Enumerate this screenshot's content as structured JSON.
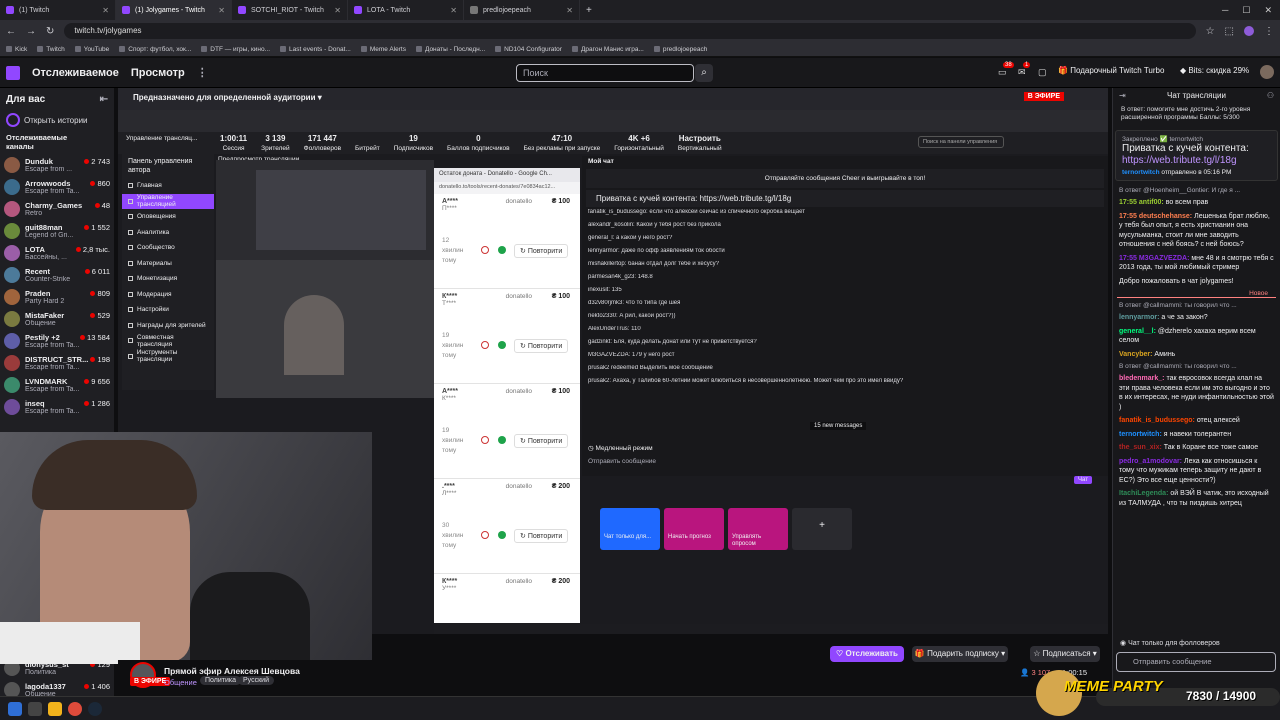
{
  "browser": {
    "tabs": [
      {
        "label": "(1) Twitch",
        "active": false
      },
      {
        "label": "(1) Jolygames - Twitch",
        "active": true
      },
      {
        "label": "SOTCHI_RIOT - Twitch",
        "active": false
      },
      {
        "label": "LOTA - Twitch",
        "active": false
      },
      {
        "label": "predlojoepeach",
        "active": false
      }
    ],
    "url": "twitch.tv/jolygames",
    "bookmarks": [
      "Kick",
      "Twitch",
      "YouTube",
      "Спорт: футбол, хок...",
      "DTF — игры, кино...",
      "Last events - Donat...",
      "Meme Alerts",
      "Донаты - Последн...",
      "ND104 Configurator",
      "Драгон Манис игра...",
      "predlojoepeach"
    ]
  },
  "header": {
    "following": "Отслеживаемое",
    "browse": "Просмотр",
    "search_placeholder": "Поиск",
    "notif_badge_1": "38",
    "notif_badge_2": "1",
    "turbo": "Подарочный Twitch Turbo",
    "bits": "Bits: скидка 29%"
  },
  "sidebar": {
    "title": "Для вас",
    "stories": "Открыть истории",
    "followed": "Отслеживаемые каналы",
    "channels": [
      {
        "name": "Dunduk",
        "game": "Escape from ...",
        "viewers": "2 743",
        "extra": "Скидка • Закончивается"
      },
      {
        "name": "Arrowwoods",
        "game": "Escape from Ta...",
        "viewers": "860"
      },
      {
        "name": "Charmy_Games",
        "game": "Retro",
        "viewers": "48"
      },
      {
        "name": "guit88man",
        "game": "Legend of Gri...",
        "viewers": "1 552"
      },
      {
        "name": "LOTA",
        "game": "Бассейны, ...",
        "viewers": "2,8 тыс."
      },
      {
        "name": "Recent",
        "game": "Counter-Strike",
        "viewers": "6 011"
      },
      {
        "name": "Praden",
        "game": "Party Hard 2",
        "viewers": "809"
      },
      {
        "name": "MistaFaker",
        "game": "Общение",
        "viewers": "529"
      },
      {
        "name": "Pestily +2",
        "game": "Escape from Ta...",
        "viewers": "13 584"
      },
      {
        "name": "DISTRUCT_STR...",
        "game": "Escape from Ta...",
        "viewers": "198"
      },
      {
        "name": "LVNDMARK",
        "game": "Escape from Ta...",
        "viewers": "9 656"
      },
      {
        "name": "inseq",
        "game": "Escape from Ta...",
        "viewers": "1 286"
      }
    ],
    "bottom_channels": [
      {
        "name": "dionysus_st",
        "game": "Политика",
        "viewers": "129"
      },
      {
        "name": "lagoda1337",
        "game": "Общение",
        "viewers": "1 406"
      }
    ]
  },
  "dashboard": {
    "audience": "Предназначено для определенной аудитории",
    "live": "В ЭФИРЕ",
    "title": "Управление трансляц...",
    "stats": [
      {
        "v": "1:00:11",
        "l": "Сессия"
      },
      {
        "v": "3 139",
        "l": "Зрителей"
      },
      {
        "v": "171 447",
        "l": "Фолловеров"
      },
      {
        "v": "",
        "l": "Битрейт"
      },
      {
        "v": "19",
        "l": "Подписчиков"
      },
      {
        "v": "0",
        "l": "Баллов подписчиков"
      },
      {
        "v": "47:10",
        "l": "Без рекламы при запуске"
      },
      {
        "v": "4K +6",
        "l": "Горизонтальный"
      },
      {
        "v": "Настроить",
        "l": "Вертикальный"
      }
    ],
    "panel_title": "Панель управления автора",
    "menu": [
      "Главная",
      "Управление трансляцией",
      "Оповещения",
      "Аналитика",
      "Сообщество",
      "Материалы",
      "Монетизация",
      "Модерация",
      "Настройки",
      "Награды для зрителей",
      "Совместная трансляция",
      "Инструменты трансляции"
    ],
    "preview_label": "Предпросмотр трансляции",
    "chat_label": "Мой чат",
    "search_panel": "Поиск на панели управления"
  },
  "donations": {
    "window_title": "Остаток доната - Donatello - Google Ch...",
    "url": "donatello.to/tools/recent-donates/7e0834ac12...",
    "retry": "Повторити",
    "items": [
      {
        "name": "А****",
        "sub": "П****",
        "src": "donatello",
        "amount": "₴ 100",
        "time": "12 хвилин тому"
      },
      {
        "name": "К****",
        "sub": "Т****",
        "src": "donatello",
        "amount": "₴ 100",
        "time": "19 хвилин тому"
      },
      {
        "name": "А****",
        "sub": "К****",
        "src": "donatello",
        "amount": "₴ 100",
        "time": "19 хвилин тому"
      },
      {
        "name": ".****",
        "sub": "Л****",
        "src": "donatello",
        "amount": "₴ 200",
        "time": "30 хвилин тому"
      },
      {
        "name": "К****",
        "sub": "У****",
        "src": "donatello",
        "amount": "₴ 200",
        "time": ""
      }
    ]
  },
  "dash_chat": {
    "cheer": "Отправляйте сообщения Cheer и выигрывайте в топ!",
    "pinned": "Приватка с кучей контента: https://web.tribute.tg/l/18g",
    "lines": [
      "fanatik_is_budussego: если что алексей сейчас из спичечного окробка вещает",
      "alexandr_kosolin: Какой у тебя рост без прикола",
      "general_l: а какой у него рост?",
      "lennyarmor: даже по офф заявлениям ток обости",
      "mishakillertop: банан отдал долг тебе и хесусу?",
      "parmesan4k_g23: 148.8",
      "inexusit: 135",
      "d32v80rjmk3: что то типа где шея",
      "nekto2330: А рил, какой рост?))",
      "AlexUnderTrus: 110",
      "gadzinkt: Бля, куда делать донат или тут не приветствуется?",
      "M3GAZVEZDA: 179 у него рост",
      "prusak2 redeemed Выделить мое сообщение",
      "prusak2: Ахаха, у Талибов 60-летний может влюбиться в несовершеннолетнюю. Может чем про это имел ввиду?"
    ],
    "new_messages": "15 new messages",
    "slow_mode": "Медленный режим",
    "send_placeholder": "Отправить сообщение",
    "chat_btn": "Чат",
    "actions": [
      "Чат только для...",
      "Начать прогноз",
      "Управлять опросом"
    ]
  },
  "stream_info": {
    "live": "В ЭФИРЕ",
    "title": "Прямой эфир Алексея Шевцова",
    "category": "Общение",
    "tags": [
      "Политика",
      "Русский"
    ],
    "follow": "Отслеживать",
    "gift": "Подарить подписку",
    "subscribe": "Подписаться",
    "viewers": "3 107",
    "uptime": "1:00:15"
  },
  "chat": {
    "title": "Чат трансляции",
    "hype": "В ответ: помогите мне достичь 2-го уровня расширенной программы Баллы: 5/300",
    "pinned_label": "Закреплено ✅ ternortwitch",
    "pinned_text": "Приватка с кучей контента:",
    "pinned_link": "https://web.tribute.tg/l/18g",
    "pinned_by": "ternortwitch",
    "pinned_time": "отправлено в 05:16 PM",
    "new_label": "Новое",
    "messages": [
      {
        "reply": "В ответ @Hoenheim__Gontier: И где я ...",
        "user": "17:55 antif00:",
        "text": "во всем прав",
        "color": "#9acd32"
      },
      {
        "user": "17:55 deutschehanse:",
        "text": "Лешенька брат люблю, у тебя был опыт, я есть христианин она мусульманка, стоит ли мне заводить отношения с ней боясь? с ней боюсь?",
        "color": "#ff7f50"
      },
      {
        "user": "17:55 M3GAZVEZDA:",
        "text": "мне 48 и я смотрю тебя с 2013 года, ты мой любимый стример",
        "color": "#8a2be2"
      },
      {
        "user": "",
        "text": "Добро пожаловать в чат jolygames!",
        "color": "#adadb8"
      },
      {
        "reply": "В ответ @callmammi: ты говорил что ...",
        "user": "lennyarmor:",
        "text": "а че за закон?",
        "color": "#5f9ea0"
      },
      {
        "user": "general__l:",
        "text": "@dzherelo хахаха верим всем селом",
        "color": "#00ff7f"
      },
      {
        "user": "Vancyber:",
        "text": "Аминь",
        "color": "#daa520"
      },
      {
        "reply": "В ответ @callmammi: ты говорил что ...",
        "user": "bledenmark_:",
        "text": "так евросовок всегда клал на эти права человека если им это выгодно и это в их интересах, не нуди инфантильностью этой )",
        "color": "#ff69b4"
      },
      {
        "user": "fanatik_is_budussego:",
        "text": "отец алексей",
        "color": "#ff4500"
      },
      {
        "user": "ternortwitch:",
        "text": "я навеки толерантен",
        "color": "#1e90ff"
      },
      {
        "user": "the_sun_xix:",
        "text": "Так в Коране все тоже самое",
        "color": "#b22222"
      },
      {
        "user": "pedro_a1modovar:",
        "text": "Леха как относишься к тому что мужикам теперь защиту не дают в ЕС?) Это все еще ценности?)",
        "color": "#8a2be2"
      },
      {
        "user": "ItachiLegenda:",
        "text": "ой ВЭЙ В чатик, это исходный из ТАЛМУДА , что ты пиздишь хитрец",
        "color": "#2e8b57"
      }
    ],
    "followers_only": "Чат только для фолловеров",
    "send_placeholder": "Отправить сообщение"
  },
  "overlay": {
    "title": "MEME PARTY",
    "count": "7830 / 14900"
  }
}
